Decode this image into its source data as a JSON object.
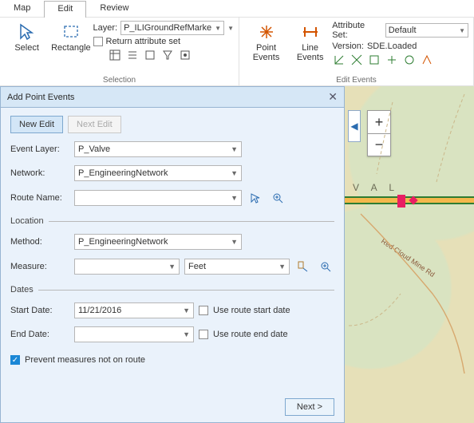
{
  "tabs": {
    "map": "Map",
    "edit": "Edit",
    "review": "Review",
    "active": "edit"
  },
  "ribbon": {
    "selection": {
      "label": "Selection",
      "select": "Select",
      "rectangle": "Rectangle",
      "layer_label": "Layer:",
      "layer_value": "P_ILIGroundRefMarkers",
      "return_attr": "Return attribute set"
    },
    "edit_events": {
      "label": "Edit Events",
      "point_events": "Point\nEvents",
      "line_events": "Line\nEvents",
      "attr_set_label": "Attribute Set:",
      "attr_set_value": "Default",
      "version_label": "Version:",
      "version_value": "SDE.Loaded"
    }
  },
  "panel": {
    "title": "Add Point Events",
    "tabs": {
      "new": "New Edit",
      "next": "Next Edit"
    },
    "event_layer_label": "Event Layer:",
    "event_layer_value": "P_Valve",
    "network_label": "Network:",
    "network_value": "P_EngineeringNetwork",
    "route_label": "Route Name:",
    "route_value": "",
    "loc_section": "Location",
    "method_label": "Method:",
    "method_value": "P_EngineeringNetwork",
    "measure_label": "Measure:",
    "measure_value": "",
    "measure_unit": "Feet",
    "dates_section": "Dates",
    "start_label": "Start Date:",
    "start_value": "11/21/2016",
    "start_chk": "Use route start date",
    "end_label": "End Date:",
    "end_value": "",
    "end_chk": "Use route end date",
    "prevent": "Prevent measures not on route",
    "next_btn": "Next >"
  },
  "map": {
    "area_label": "V A L",
    "road_label": "Red Cloud Mine Rd"
  }
}
